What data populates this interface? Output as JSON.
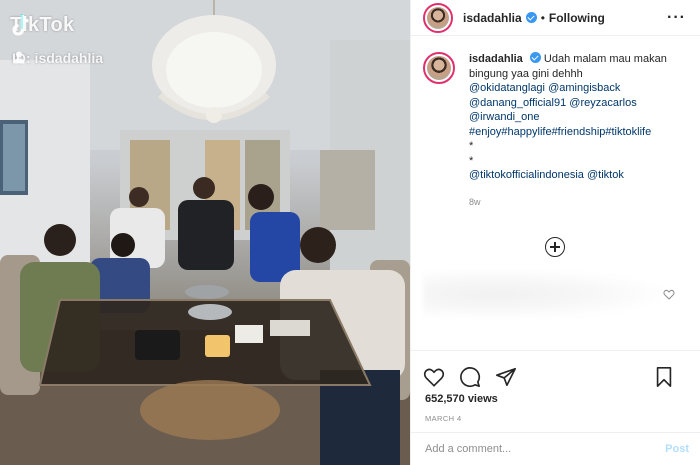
{
  "media": {
    "watermark": {
      "logo_icon": "tiktok-note-icon",
      "brand": "TikTok",
      "id_icon": "user-icon",
      "id_text": "ID: isdadahlia"
    },
    "scene_colors": {
      "wall": "#d6d9dc",
      "table": "#3a3026",
      "floor": "#5b4d40"
    }
  },
  "header": {
    "username": "isdadahlia",
    "verified_icon": "verified-badge-icon",
    "separator": "•",
    "follow_status": "Following",
    "more_icon": "more-options-icon"
  },
  "caption": {
    "username": "isdadahlia",
    "text_lines": [
      "Udah malam mau makan",
      "bingung yaa gini dehhh"
    ],
    "mentions_line1": [
      "@okidatanglagi",
      "@amingisback"
    ],
    "mentions_line2": [
      "@danang_official91",
      "@reyzacarlos"
    ],
    "mentions_line3": [
      "@irwandi_one"
    ],
    "hashtags": "#enjoy#happylife#friendship#tiktoklife",
    "bullet1": "*",
    "bullet2": "*",
    "mentions_line4": [
      "@tiktokofficialindonesia",
      "@tiktok"
    ],
    "time_ago": "8w"
  },
  "comments": {
    "load_more_icon": "plus-circle-icon",
    "like_icon": "heart-outline-icon"
  },
  "actions": {
    "like_icon": "heart-icon",
    "comment_icon": "comment-bubble-icon",
    "share_icon": "paper-plane-icon",
    "save_icon": "bookmark-icon",
    "views": "652,570 views",
    "date": "MARCH 4"
  },
  "comment_box": {
    "placeholder": "Add a comment...",
    "post_label": "Post"
  },
  "colors": {
    "link": "#00376b",
    "verified": "#3897f0",
    "post_disabled": "#b2dffc",
    "muted": "#8e8e8e"
  }
}
